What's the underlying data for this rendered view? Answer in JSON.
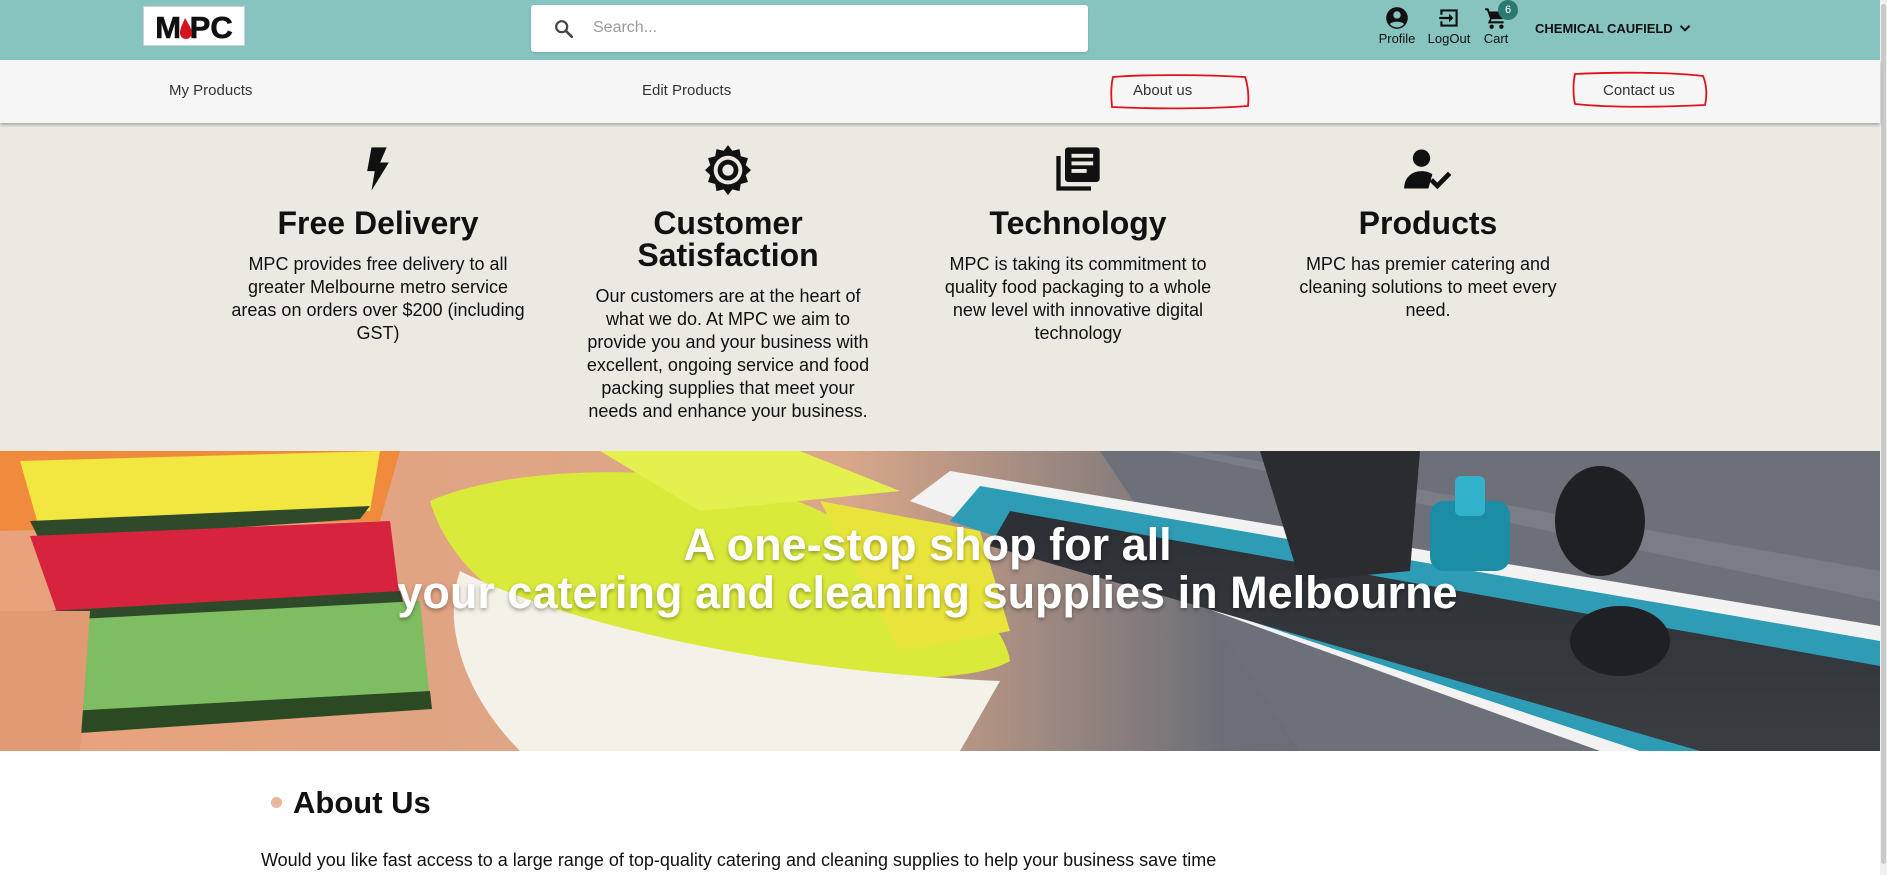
{
  "header": {
    "logo_text": "MPC",
    "search_placeholder": "Search...",
    "profile_label": "Profile",
    "logout_label": "LogOut",
    "cart_label": "Cart",
    "cart_count": "6",
    "account_name": "CHEMICAL CAUFIELD"
  },
  "nav": {
    "items": [
      {
        "label": "My Products"
      },
      {
        "label": "Edit Products"
      },
      {
        "label": "About us"
      },
      {
        "label": "Contact us"
      }
    ]
  },
  "features": [
    {
      "icon": "lightning-icon",
      "title": "Free Delivery",
      "text": "MPC provides free delivery to all greater Melbourne metro service areas on orders over $200 (including GST)"
    },
    {
      "icon": "gear-icon",
      "title": "Customer Satisfaction",
      "text": "Our customers are at the heart of what we do. At MPC we aim to provide you and your business with excellent, ongoing service and food packing supplies that meet your needs and enhance your business."
    },
    {
      "icon": "library-books-icon",
      "title": "Technology",
      "text": "MPC is taking its commitment to quality food packaging to a whole new level with innovative digital technology"
    },
    {
      "icon": "person-check-icon",
      "title": "Products",
      "text": "MPC has premier catering and cleaning solutions to meet every need."
    }
  ],
  "banner": {
    "line1": "A one-stop shop for all",
    "line2": "your catering and cleaning supplies in Melbourne"
  },
  "about": {
    "title": "About Us",
    "text": "Would you like fast access to a large range of top-quality catering and cleaning supplies to help your business save time"
  },
  "colors": {
    "topbar": "#87c4bf",
    "nav": "#f6f6f6",
    "features_bg": "#ece9e3",
    "badge": "#2b7a72",
    "annotation": "#e0121b",
    "bullet": "#eab79a"
  }
}
